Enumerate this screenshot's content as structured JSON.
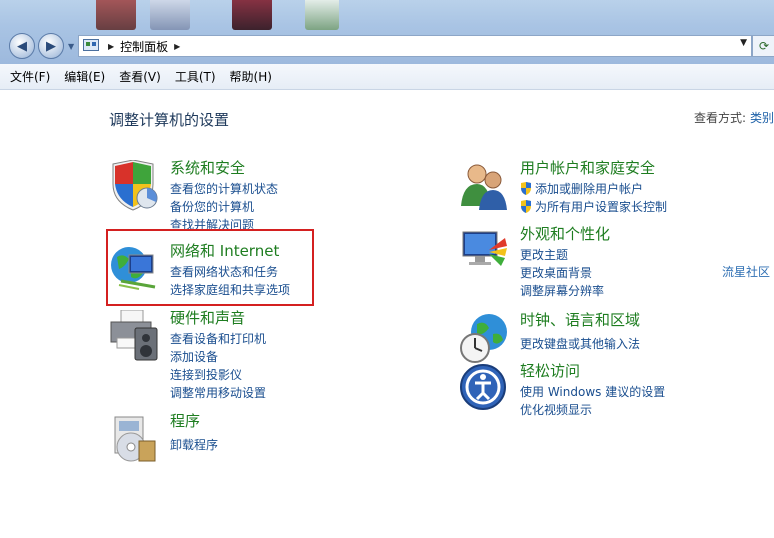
{
  "address": {
    "path": "控制面板"
  },
  "menu": [
    "文件(F)",
    "编辑(E)",
    "查看(V)",
    "工具(T)",
    "帮助(H)"
  ],
  "page_title": "调整计算机的设置",
  "view_by": {
    "label": "查看方式:",
    "value": "类别"
  },
  "categories": {
    "system": {
      "heading": "系统和安全",
      "links": [
        "查看您的计算机状态",
        "备份您的计算机",
        "查找并解决问题"
      ]
    },
    "network": {
      "heading": "网络和 Internet",
      "links": [
        "查看网络状态和任务",
        "选择家庭组和共享选项"
      ]
    },
    "hardware": {
      "heading": "硬件和声音",
      "links": [
        "查看设备和打印机",
        "添加设备",
        "连接到投影仪",
        "调整常用移动设置"
      ]
    },
    "programs": {
      "heading": "程序",
      "links": [
        "卸载程序"
      ]
    },
    "users": {
      "heading": "用户帐户和家庭安全",
      "links": [
        "添加或删除用户帐户",
        "为所有用户设置家长控制"
      ]
    },
    "appearance": {
      "heading": "外观和个性化",
      "links": [
        "更改主题",
        "更改桌面背景",
        "调整屏幕分辨率"
      ]
    },
    "clock": {
      "heading": "时钟、语言和区域",
      "links": [
        "更改键盘或其他输入法"
      ]
    },
    "ease": {
      "heading": "轻松访问",
      "links": [
        "使用 Windows 建议的设置",
        "优化视频显示"
      ]
    }
  },
  "side_link": "流星社区",
  "colors": {
    "heading": "#1e7d20",
    "link": "#1a4e8f",
    "highlight": "#d42020"
  }
}
